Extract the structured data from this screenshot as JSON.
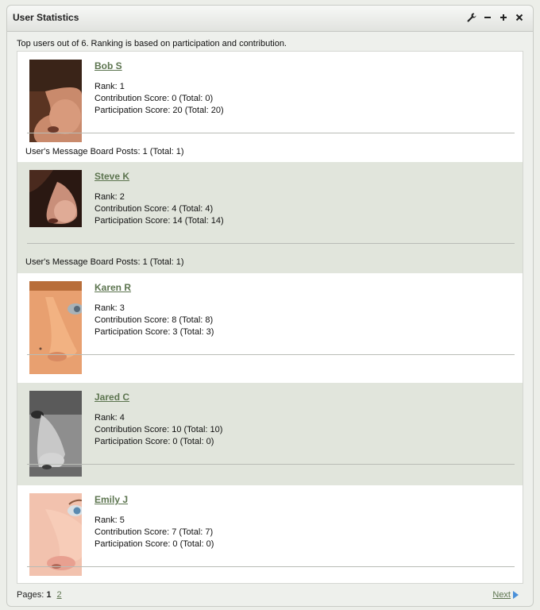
{
  "portlet": {
    "title": "User Statistics",
    "controls": {
      "configure_icon": "wrench-icon",
      "minimize_icon": "minimize-icon",
      "maximize_icon": "plus-icon",
      "close_icon": "close-icon"
    }
  },
  "intro": "Top users out of 6. Ranking is based on participation and contribution.",
  "users": [
    {
      "name": "Bob S",
      "rank": "Rank: 1",
      "contribution": "Contribution Score: 0 (Total: 0)",
      "participation": "Participation Score: 20 (Total: 20)",
      "posts": "User's Message Board Posts: 1 (Total: 1)"
    },
    {
      "name": "Steve K",
      "rank": "Rank: 2",
      "contribution": "Contribution Score: 4 (Total: 4)",
      "participation": "Participation Score: 14 (Total: 14)",
      "posts": "User's Message Board Posts: 1 (Total: 1)"
    },
    {
      "name": "Karen R",
      "rank": "Rank: 3",
      "contribution": "Contribution Score: 8 (Total: 8)",
      "participation": "Participation Score: 3 (Total: 3)"
    },
    {
      "name": "Jared C",
      "rank": "Rank: 4",
      "contribution": "Contribution Score: 10 (Total: 10)",
      "participation": "Participation Score: 0 (Total: 0)"
    },
    {
      "name": "Emily J",
      "rank": "Rank: 5",
      "contribution": "Contribution Score: 7 (Total: 7)",
      "participation": "Participation Score: 0 (Total: 0)"
    }
  ],
  "pager": {
    "label": "Pages:",
    "current": "1",
    "page2": "2",
    "next": "Next"
  }
}
